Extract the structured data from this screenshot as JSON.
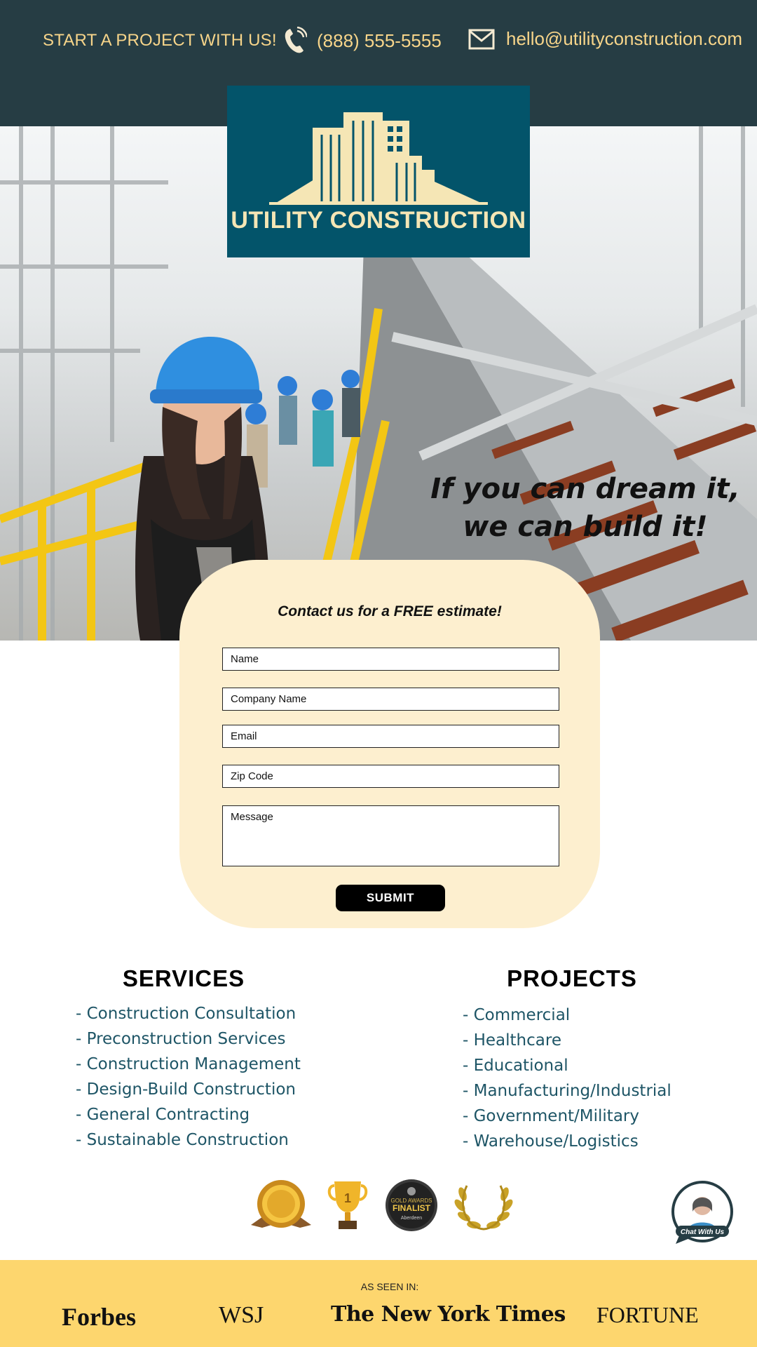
{
  "topbar": {
    "cta": "START A PROJECT WITH US!",
    "phone": "(888) 555-5555",
    "email": "hello@utilityconstruction.com"
  },
  "logo": {
    "name": "UTILITY CONSTRUCTION"
  },
  "hero": {
    "tagline_1": "If you can dream it,",
    "tagline_2": "we can build it!"
  },
  "form": {
    "title": "Contact us for a FREE estimate!",
    "fields": {
      "name": "Name",
      "company": "Company Name",
      "email": "Email",
      "zip": "Zip Code",
      "message": "Message"
    },
    "submit": "SUBMIT"
  },
  "services": {
    "title": "SERVICES",
    "items": [
      "- Construction Consultation",
      "- Preconstruction Services",
      "- Construction Management",
      "- Design-Build Construction",
      "- General Contracting",
      "- Sustainable Construction"
    ]
  },
  "projects": {
    "title": "PROJECTS",
    "items": [
      "- Commercial",
      "- Healthcare",
      "- Educational",
      "- Manufacturing/Industrial",
      "- Government/Military",
      "- Warehouse/Logistics"
    ]
  },
  "awards": {
    "finalist_top": "GOLD AWARDS",
    "finalist_main": "FINALIST",
    "finalist_sub": "Aberdeen",
    "trophy_number": "1"
  },
  "chat": {
    "label": "Chat With Us"
  },
  "footer": {
    "seen_in": "AS SEEN IN:",
    "press": [
      "Forbes",
      "WSJ",
      "The New York Times",
      "FORTUNE"
    ]
  },
  "colors": {
    "topbar_bg": "#263d44",
    "accent_text": "#f7d58a",
    "logo_bg": "#03546a",
    "form_bg": "#fdefcf",
    "list_text": "#1e5566",
    "footer_bg": "#fdd66e"
  }
}
